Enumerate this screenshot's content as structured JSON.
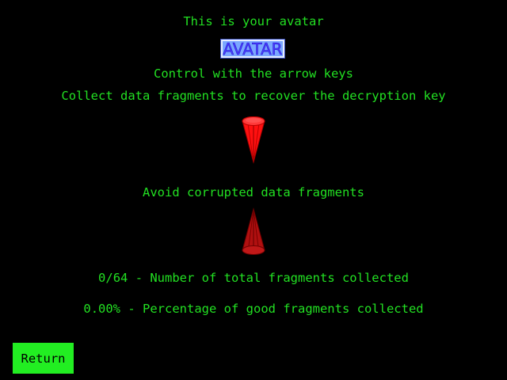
{
  "screen": {
    "title": "This is your avatar",
    "avatar_label": "AVATAR",
    "controls_text": "Control with the arrow keys",
    "collect_text": "Collect data fragments to recover the decryption key",
    "avoid_text": "Avoid corrupted data fragments",
    "total_collected": "0/64 - Number of total fragments collected",
    "good_percentage": "0.00% - Percentage of good fragments collected",
    "return_label": "Return"
  },
  "colors": {
    "background": "#000000",
    "text": "#22e022",
    "good_fragment": "#ff1010",
    "corrupted_fragment": "#b01010",
    "return_button": "#22ee22",
    "avatar_fill": "#7aa7ff"
  },
  "icons": {
    "good_fragment": "downward-red-crystal-icon",
    "corrupted_fragment": "upward-dark-red-crystal-icon"
  }
}
